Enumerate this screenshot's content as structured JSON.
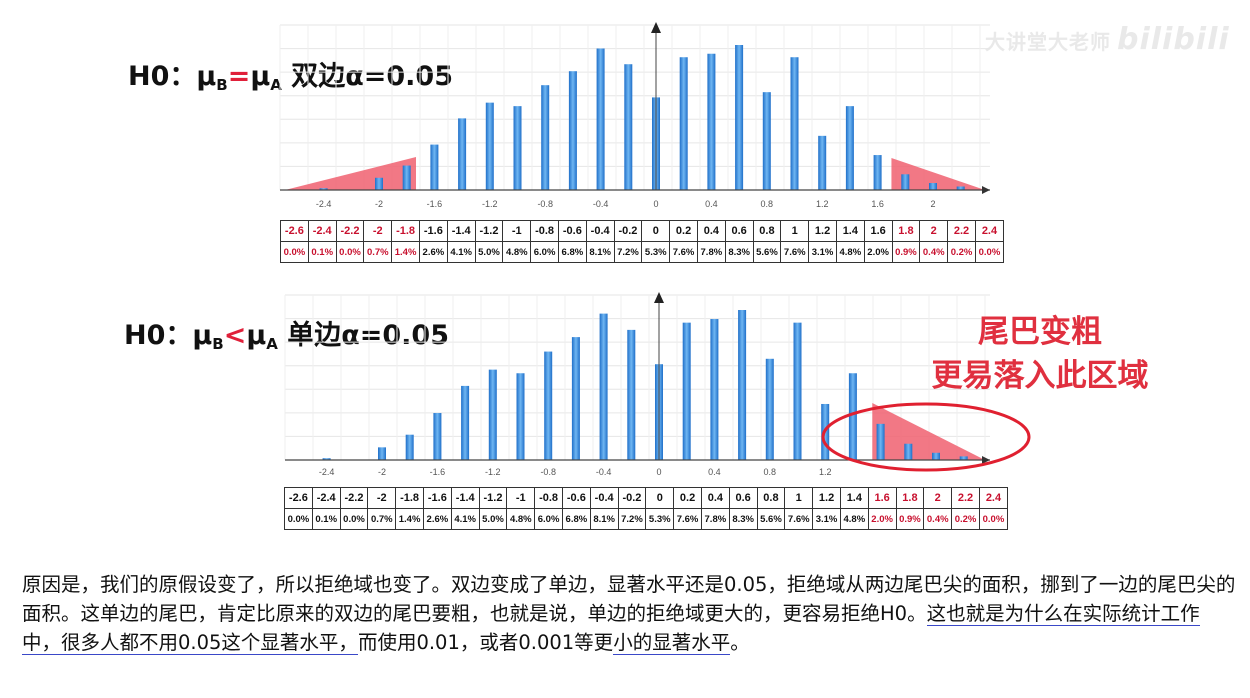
{
  "watermark": {
    "text": "大讲堂大老师",
    "logo": "bilibili"
  },
  "charts": [
    {
      "title_prefix": "H0：μ",
      "sub_b": "B",
      "relation": "=",
      "mu_a": "μ",
      "sub_a": "A",
      "title_suffix": "  双边α=0.05"
    },
    {
      "title_prefix": "H0：μ",
      "sub_b": "B",
      "relation": "<",
      "mu_a": "μ",
      "sub_a": "A",
      "title_suffix": "  单边α=0.05"
    }
  ],
  "chart_data": [
    {
      "type": "bar",
      "title": "H0：μB=μA 双边α=0.05",
      "x": [
        -2.6,
        -2.4,
        -2.2,
        -2,
        -1.8,
        -1.6,
        -1.4,
        -1.2,
        -1,
        -0.8,
        -0.6,
        -0.4,
        -0.2,
        0,
        0.2,
        0.4,
        0.6,
        0.8,
        1,
        1.2,
        1.4,
        1.6,
        1.8,
        2,
        2.2,
        2.4
      ],
      "values": [
        0.0,
        0.1,
        0.0,
        0.7,
        1.4,
        2.6,
        4.1,
        5.0,
        4.8,
        6.0,
        6.8,
        8.1,
        7.2,
        5.3,
        7.6,
        7.8,
        8.3,
        5.6,
        7.6,
        3.1,
        4.8,
        2.0,
        0.9,
        0.4,
        0.2,
        0.0
      ],
      "x_ticks": [
        "-2.4",
        "-2",
        "-1.6",
        "-1.2",
        "-0.8",
        "-0.4",
        "0",
        "0.4",
        "0.8",
        "1.2",
        "1.6",
        "2"
      ],
      "rejection_region": "two-sided",
      "table_x": [
        "-2.6",
        "-2.4",
        "-2.2",
        "-2",
        "-1.8",
        "-1.6",
        "-1.4",
        "-1.2",
        "-1",
        "-0.8",
        "-0.6",
        "-0.4",
        "-0.2",
        "0",
        "0.2",
        "0.4",
        "0.6",
        "0.8",
        "1",
        "1.2",
        "1.4",
        "1.6",
        "1.8",
        "2",
        "2.2",
        "2.4"
      ],
      "table_pct": [
        "0.0%",
        "0.1%",
        "0.0%",
        "0.7%",
        "1.4%",
        "2.6%",
        "4.1%",
        "5.0%",
        "4.8%",
        "6.0%",
        "6.8%",
        "8.1%",
        "7.2%",
        "5.3%",
        "7.6%",
        "7.8%",
        "8.3%",
        "5.6%",
        "7.6%",
        "3.1%",
        "4.8%",
        "2.0%",
        "0.9%",
        "0.4%",
        "0.2%",
        "0.0%"
      ],
      "red_columns": [
        0,
        1,
        2,
        3,
        4,
        22,
        23,
        24,
        25
      ]
    },
    {
      "type": "bar",
      "title": "H0：μB<μA 单边α=0.05",
      "x": [
        -2.6,
        -2.4,
        -2.2,
        -2,
        -1.8,
        -1.6,
        -1.4,
        -1.2,
        -1,
        -0.8,
        -0.6,
        -0.4,
        -0.2,
        0,
        0.2,
        0.4,
        0.6,
        0.8,
        1,
        1.2,
        1.4,
        1.6,
        1.8,
        2,
        2.2,
        2.4
      ],
      "values": [
        0.0,
        0.1,
        0.0,
        0.7,
        1.4,
        2.6,
        4.1,
        5.0,
        4.8,
        6.0,
        6.8,
        8.1,
        7.2,
        5.3,
        7.6,
        7.8,
        8.3,
        5.6,
        7.6,
        3.1,
        4.8,
        2.0,
        0.9,
        0.4,
        0.2,
        0.0
      ],
      "x_ticks": [
        "-2.4",
        "-2",
        "-1.6",
        "-1.2",
        "-0.8",
        "-0.4",
        "0",
        "0.4",
        "0.8",
        "1.2"
      ],
      "rejection_region": "right-tail",
      "table_x": [
        "-2.6",
        "-2.4",
        "-2.2",
        "-2",
        "-1.8",
        "-1.6",
        "-1.4",
        "-1.2",
        "-1",
        "-0.8",
        "-0.6",
        "-0.4",
        "-0.2",
        "0",
        "0.2",
        "0.4",
        "0.6",
        "0.8",
        "1",
        "1.2",
        "1.4",
        "1.6",
        "1.8",
        "2",
        "2.2",
        "2.4"
      ],
      "table_pct": [
        "0.0%",
        "0.1%",
        "0.0%",
        "0.7%",
        "1.4%",
        "2.6%",
        "4.1%",
        "5.0%",
        "4.8%",
        "6.0%",
        "6.8%",
        "8.1%",
        "7.2%",
        "5.3%",
        "7.6%",
        "7.8%",
        "8.3%",
        "5.6%",
        "7.6%",
        "3.1%",
        "4.8%",
        "2.0%",
        "0.9%",
        "0.4%",
        "0.2%",
        "0.0%"
      ],
      "red_columns": [
        21,
        22,
        23,
        24,
        25
      ]
    }
  ],
  "annotation": {
    "line1": "尾巴变粗",
    "line2": "更易落入此区域"
  },
  "paragraph": {
    "part1": "原因是，我们的原假设变了，所以拒绝域也变了。双边变成了单边，显著水平还是0.05，拒绝域从两边尾巴尖的面积，挪到了一边的尾巴尖的面积。这单边的尾巴，肯定比原来的双边的尾巴要粗，也就是说，单边的拒绝域更大的，更容易拒绝H0。",
    "ul1": "这也就是为什么在实际统计工作中，",
    "ul2": "很多人都不用0.05这个显著水平，",
    "part2": "而使用0.01，或者0.001等更",
    "ul3": "小的显著水平",
    "part3": "。"
  },
  "colors": {
    "bar": "#3b8ee0",
    "reject_fill": "#f06070",
    "title_relation": "#e0203a",
    "red_text": "#c8102e",
    "ellipse": "#e02030",
    "underline": "#3a48c8"
  }
}
